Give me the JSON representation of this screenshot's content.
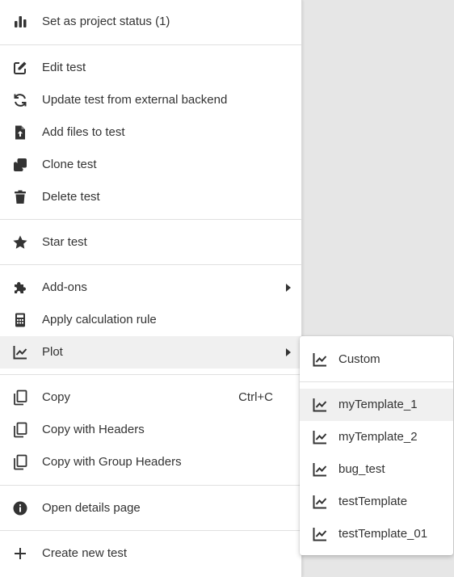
{
  "menu": {
    "items": [
      {
        "label": "Set as project status (1)",
        "icon": "bar-chart-icon"
      },
      {
        "label": "Edit test",
        "icon": "edit-icon"
      },
      {
        "label": "Update test from external backend",
        "icon": "refresh-icon"
      },
      {
        "label": "Add files to test",
        "icon": "file-upload-icon"
      },
      {
        "label": "Clone test",
        "icon": "clone-icon"
      },
      {
        "label": "Delete test",
        "icon": "trash-icon"
      },
      {
        "label": "Star test",
        "icon": "star-icon"
      },
      {
        "label": "Add-ons",
        "icon": "puzzle-icon",
        "has_submenu": true
      },
      {
        "label": "Apply calculation rule",
        "icon": "calculator-icon"
      },
      {
        "label": "Plot",
        "icon": "line-chart-icon",
        "has_submenu": true,
        "highlighted": true
      },
      {
        "label": "Copy",
        "icon": "copy-icon",
        "shortcut": "Ctrl+C"
      },
      {
        "label": "Copy with Headers",
        "icon": "copy-icon"
      },
      {
        "label": "Copy with Group Headers",
        "icon": "copy-icon"
      },
      {
        "label": "Open details page",
        "icon": "info-icon"
      },
      {
        "label": "Create new test",
        "icon": "plus-icon"
      }
    ]
  },
  "plot_submenu": {
    "items": [
      {
        "label": "Custom",
        "icon": "line-chart-icon"
      },
      {
        "label": "myTemplate_1",
        "icon": "line-chart-icon",
        "highlighted": true
      },
      {
        "label": "myTemplate_2",
        "icon": "line-chart-icon"
      },
      {
        "label": "bug_test",
        "icon": "line-chart-icon"
      },
      {
        "label": "testTemplate",
        "icon": "line-chart-icon"
      },
      {
        "label": "testTemplate_01",
        "icon": "line-chart-icon"
      }
    ]
  },
  "colors": {
    "icon": "#333333",
    "highlight": "#f0f0f0",
    "separator": "#e0e0e0"
  }
}
